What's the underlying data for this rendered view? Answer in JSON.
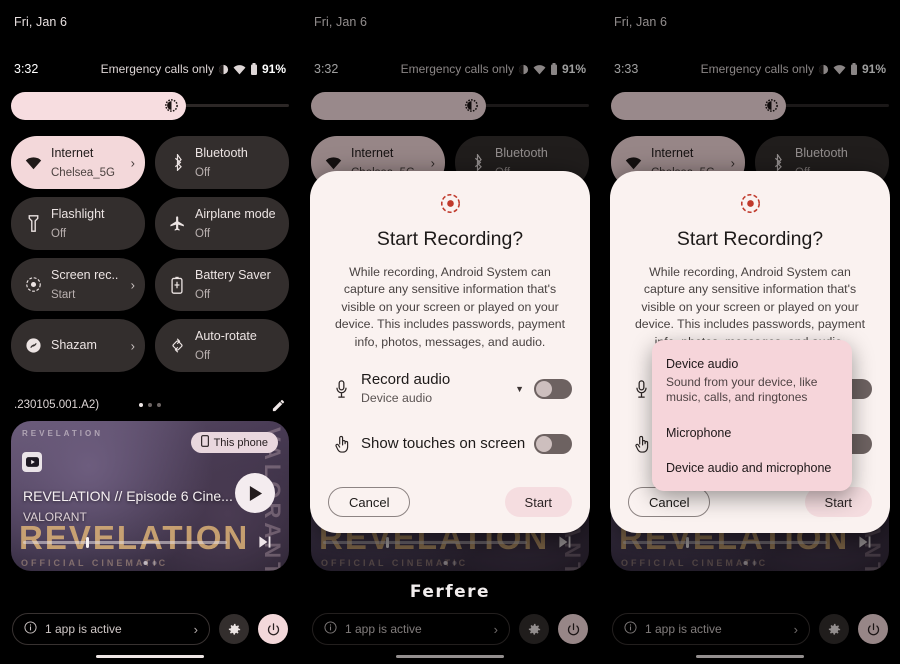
{
  "panels": [
    {
      "id": "panel-left",
      "date": "Fri, Jan 6",
      "clock": "3:32",
      "carrier": "Emergency calls only",
      "battery": "91%",
      "dialog_visible": false,
      "dropdown_visible": false
    },
    {
      "id": "panel-middle",
      "date": "Fri, Jan 6",
      "clock": "3:32",
      "carrier": "Emergency calls only",
      "battery": "91%",
      "dialog_visible": true,
      "dropdown_visible": false
    },
    {
      "id": "panel-right",
      "date": "Fri, Jan 6",
      "clock": "3:33",
      "carrier": "Emergency calls only",
      "battery": "91%",
      "dialog_visible": true,
      "dropdown_visible": true
    }
  ],
  "quick_settings": {
    "brightness_percent": 63,
    "tiles": [
      {
        "label": "Internet",
        "sub": "Chelsea_5G",
        "icon": "wifi-icon",
        "active": true,
        "chevron": "›"
      },
      {
        "label": "Bluetooth",
        "sub": "Off",
        "icon": "bluetooth-icon",
        "active": false,
        "chevron": ""
      },
      {
        "label": "Flashlight",
        "sub": "Off",
        "icon": "flashlight-icon",
        "active": false,
        "chevron": ""
      },
      {
        "label": "Airplane mode",
        "sub": "Off",
        "icon": "airplane-icon",
        "active": false,
        "chevron": ""
      },
      {
        "label": "Screen rec..",
        "sub": "Start",
        "icon": "screen-record-icon",
        "active": false,
        "chevron": "›"
      },
      {
        "label": "Battery Saver",
        "sub": "Off",
        "icon": "battery-saver-icon",
        "active": false,
        "chevron": ""
      },
      {
        "label": "Shazam",
        "sub": "",
        "icon": "shazam-icon",
        "active": false,
        "chevron": "›"
      },
      {
        "label": "Auto-rotate",
        "sub": "Off",
        "icon": "auto-rotate-icon",
        "active": false,
        "chevron": ""
      }
    ],
    "build_text": ".230105.001.A2)",
    "page_dots": 3,
    "active_dot_index": 0,
    "edit_icon": "pencil-icon"
  },
  "media": {
    "title": "REVELATION // Episode 6 Cine...",
    "artist": "VALORANT",
    "output_badge": "This phone",
    "output_icon": "phone-icon",
    "art_word": "REVELATION",
    "art_subword": "OFFICIAL CINEMATIC",
    "art_vertical": "VALORANT",
    "art_top": "REVELATION",
    "progress_percent": 31,
    "play_icon": "play-icon",
    "next_icon": "skip-next-icon",
    "app_icon": "youtube-icon"
  },
  "bottom_bar": {
    "active_apps_text": "1 app is active",
    "info_icon": "info-icon",
    "chevron": "›",
    "settings_icon": "gear-icon",
    "power_icon": "power-icon"
  },
  "dialog": {
    "record_icon": "screen-record-icon",
    "title": "Start Recording?",
    "body": "While recording, Android System can capture any sensitive information that's visible on your screen or played on your device. This includes passwords, payment info, photos, messages, and audio.",
    "options": [
      {
        "label": "Record audio",
        "sub": "Device audio",
        "icon": "microphone-icon",
        "has_caret": true,
        "toggle_on": false
      },
      {
        "label": "Show touches on screen",
        "sub": "",
        "icon": "touch-icon",
        "has_caret": false,
        "toggle_on": false
      }
    ],
    "cancel_label": "Cancel",
    "start_label": "Start"
  },
  "dropdown": {
    "items": [
      {
        "label": "Device audio",
        "sub": "Sound from your device, like music, calls, and ringtones"
      },
      {
        "label": "Microphone",
        "sub": ""
      },
      {
        "label": "Device audio and microphone",
        "sub": ""
      }
    ]
  },
  "watermark": "Ferfere",
  "colors": {
    "accent_pink": "#f3d8da",
    "tile_off": "#332e2d",
    "dialog_bg": "#faf2f0",
    "dropdown_bg": "#f6d5da",
    "record_red": "#c0392b",
    "background": "#000000"
  }
}
